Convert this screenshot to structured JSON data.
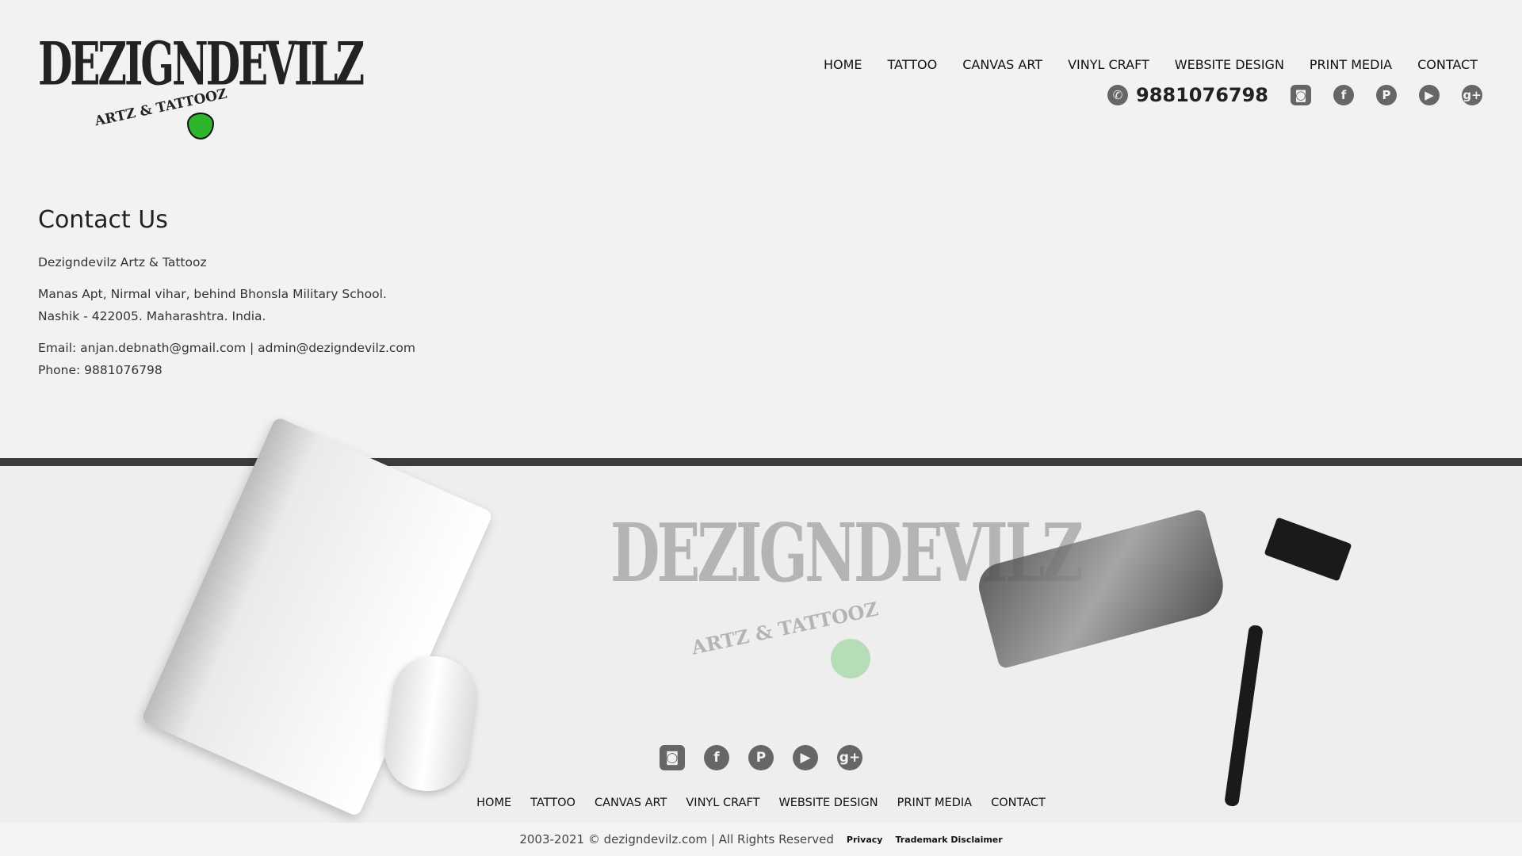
{
  "brand": {
    "name": "DEZIGNDEVILZ",
    "tagline": "ARTZ & TATTOOZ"
  },
  "nav": [
    "HOME",
    "TATTOO",
    "CANVAS ART",
    "VINYL CRAFT",
    "WEBSITE DESIGN",
    "PRINT MEDIA",
    "CONTACT"
  ],
  "header": {
    "phone": "9881076798"
  },
  "social": [
    {
      "name": "instagram-icon",
      "glyph": "◙"
    },
    {
      "name": "facebook-icon",
      "glyph": "f"
    },
    {
      "name": "pinterest-icon",
      "glyph": "P"
    },
    {
      "name": "youtube-icon",
      "glyph": "▶"
    },
    {
      "name": "google-plus-icon",
      "glyph": "g+"
    }
  ],
  "contact": {
    "title": "Contact Us",
    "company": "Dezigndevilz Artz & Tattooz",
    "address1": "Manas Apt, Nirmal vihar, behind Bhonsla Military School.",
    "address2": "Nashik - 422005. Maharashtra. India.",
    "email": "Email: anjan.debnath@gmail.com | admin@dezigndevilz.com",
    "phone": "Phone: 9881076798"
  },
  "footer": {
    "copyright": "2003-2021 © dezigndevilz.com | All Rights Reserved",
    "privacy": "Privacy",
    "trademark": "Trademark Disclaimer"
  },
  "colors": {
    "background": "#f2f2f2",
    "divider": "#3c3c3c",
    "icon": "#666666",
    "accent": "#2db52d"
  }
}
